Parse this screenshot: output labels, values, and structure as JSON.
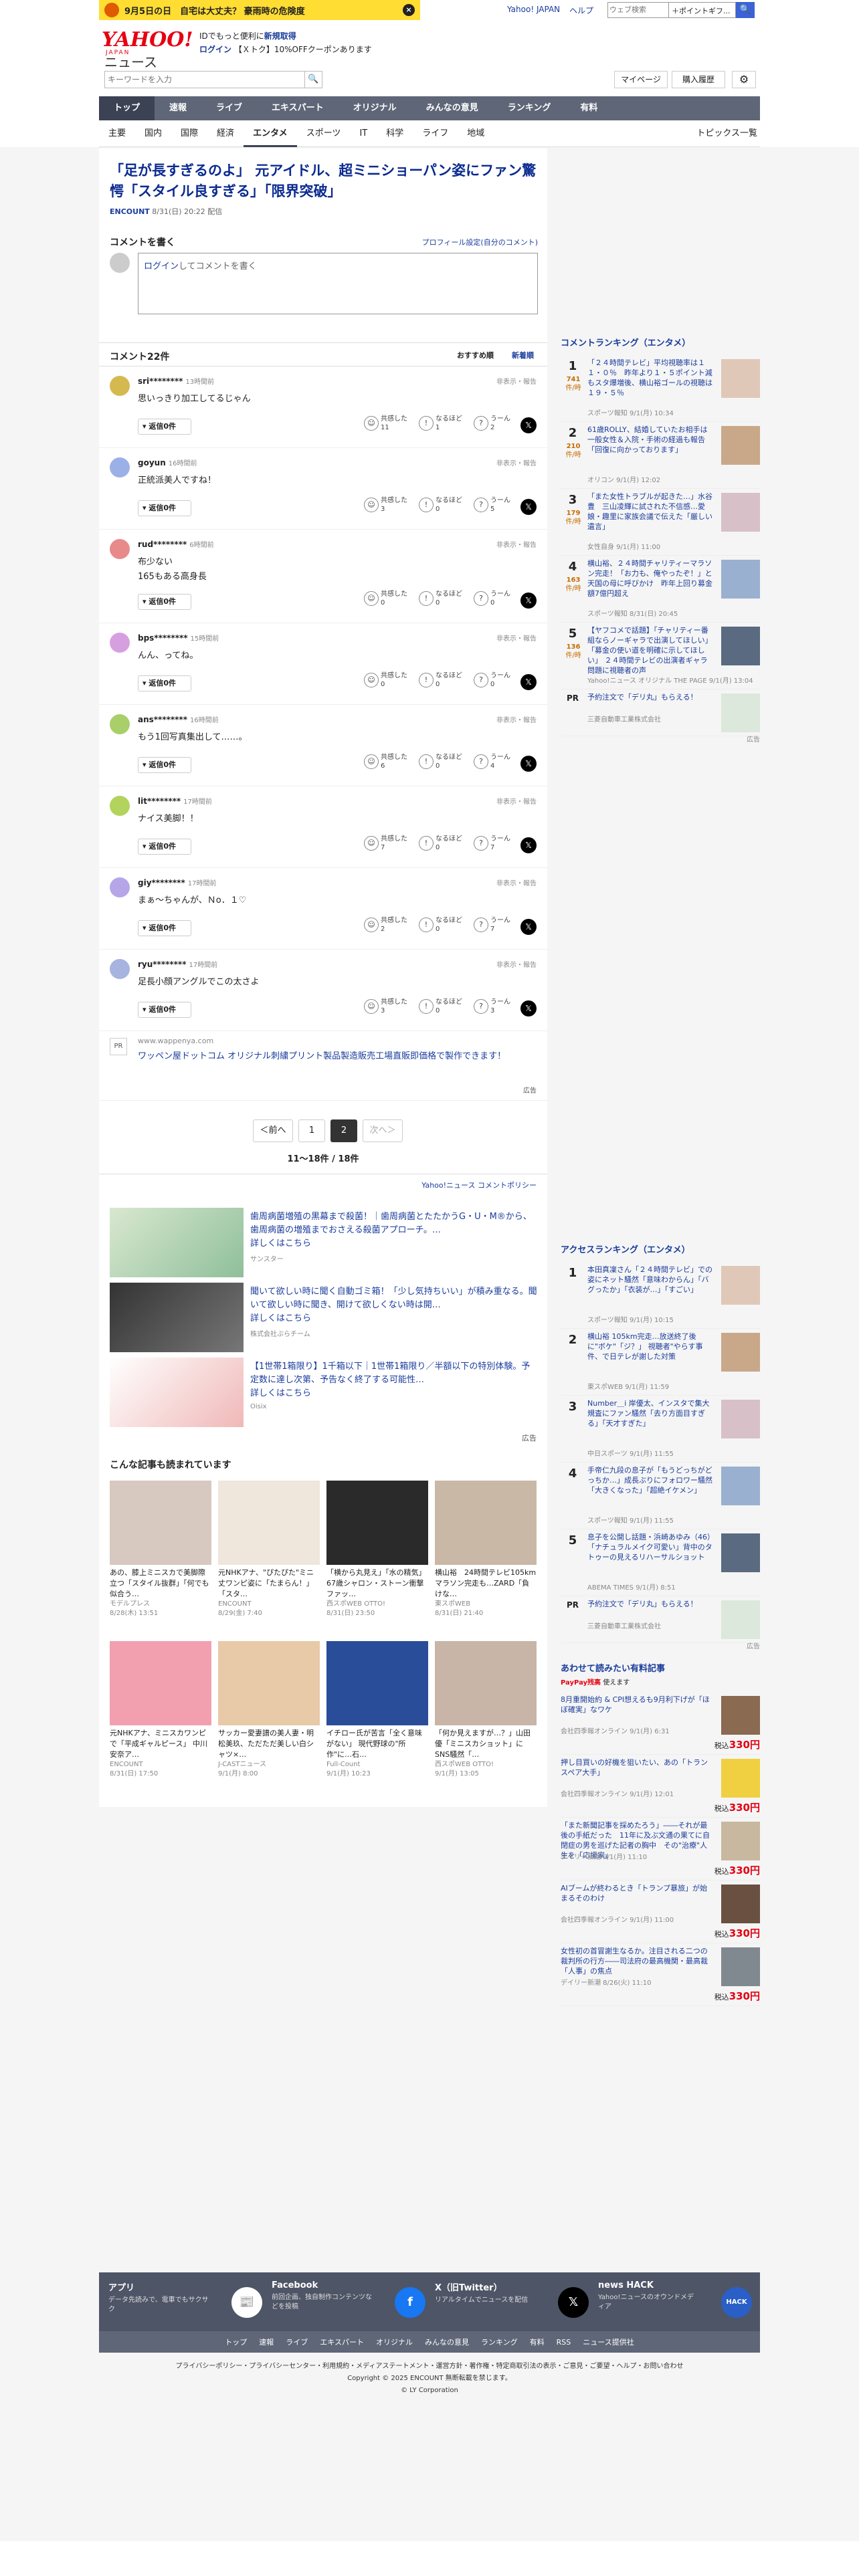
{
  "promo": {
    "text": "9月5日の日　自宅は大丈夫？ 豪雨時の危険度",
    "close": "×"
  },
  "toplinks": [
    "Yahoo! JAPAN",
    "ヘルプ"
  ],
  "topsearch": {
    "placeholder": "ウェブ検索",
    "select": "＋ポイントギフ...",
    "button": "🔍"
  },
  "logo": {
    "yahoo": "YAHOO!",
    "news": "ニュース",
    "japan": "JAPAN"
  },
  "header_info": {
    "line1": "IDでもっと便利に",
    "line1_link": "新規取得",
    "line2_login": "ログイン",
    "line2_text": "【Ｘトク】10%OFFクーポンあります"
  },
  "search": {
    "placeholder": "キーワードを入力",
    "mypage": "マイページ",
    "purchase": "購入履歴",
    "settings": "⚙"
  },
  "global_nav": [
    "トップ",
    "速報",
    "ライブ",
    "エキスパート",
    "オリジナル",
    "みんなの意見",
    "ランキング",
    "有料"
  ],
  "sub_nav": [
    "主要",
    "国内",
    "国際",
    "経済",
    "エンタメ",
    "スポーツ",
    "IT",
    "科学",
    "ライフ",
    "地域"
  ],
  "sub_nav_active": "エンタメ",
  "topics_list": "トピックス一覧",
  "article": {
    "title": "「足が長すぎるのよ」 元アイドル、超ミニショーパン姿にファン驚愕「スタイル良すぎる」「限界突破」",
    "source": "ENCOUNT",
    "date": "8/31(日) 20:22 配信"
  },
  "comment_write": {
    "title": "コメントを書く",
    "profile": "プロフィール設定(自分のコメント)",
    "login": "ログイン",
    "placeholder": "してコメントを書く"
  },
  "comments_header": {
    "title": "コメント22件",
    "sort1": "おすすめ順",
    "sort2": "新着順"
  },
  "comments": [
    {
      "user": "sri********",
      "time": "13時間前",
      "text": "思いっきり加工してるじゃん",
      "color": "#d4b94f",
      "kyokan": "11",
      "naruhodo": "1",
      "uun": "2"
    },
    {
      "user": "goyun",
      "time": "16時間前",
      "text": "正統派美人ですね！",
      "color": "#9bb0e6",
      "kyokan": "3",
      "naruhodo": "0",
      "uun": "5"
    },
    {
      "user": "rud********",
      "time": "6時間前",
      "text": "布少ない\n165もある高身長",
      "color": "#e88a8a",
      "kyokan": "0",
      "naruhodo": "0",
      "uun": "0"
    },
    {
      "user": "bps********",
      "time": "15時間前",
      "text": "んん、ってね。",
      "color": "#d6a0e0",
      "kyokan": "0",
      "naruhodo": "0",
      "uun": "0"
    },
    {
      "user": "ans********",
      "time": "16時間前",
      "text": "もう1回写真集出して……。",
      "color": "#a8cf6a",
      "kyokan": "6",
      "naruhodo": "0",
      "uun": "4"
    },
    {
      "user": "lit********",
      "time": "17時間前",
      "text": "ナイス美脚！！",
      "color": "#b2d35c",
      "kyokan": "7",
      "naruhodo": "0",
      "uun": "7"
    },
    {
      "user": "giy********",
      "time": "17時間前",
      "text": "まぁ〜ちゃんが、Ｎo．１♡",
      "color": "#b6a6e8",
      "kyokan": "2",
      "naruhodo": "0",
      "uun": "7"
    },
    {
      "user": "ryu********",
      "time": "17時間前",
      "text": "足長小顔アングルでこの太さよ",
      "color": "#a7b4e0",
      "kyokan": "3",
      "naruhodo": "0",
      "uun": "3"
    }
  ],
  "comment_labels": {
    "hide": "非表示・報告",
    "reply": "返信0件",
    "kyokan": "共感した",
    "naruhodo": "なるほど",
    "uun": "うーん"
  },
  "pr": {
    "label": "PR",
    "domain": "www.wappenya.com",
    "title": "ワッペン屋ドットコム オリジナル刺繍プリント製品製造販売工場直販即価格で製作できます！",
    "ad": "広告"
  },
  "pager": {
    "prev": "＜前へ",
    "p1": "1",
    "p2": "2",
    "next": "次へ＞",
    "count": "11〜18件 / 18件"
  },
  "policy": "Yahoo!ニュース コメントポリシー",
  "ads": [
    {
      "title": "歯周病菌増殖の黒幕まで殺菌！｜歯周病菌とたたかうG・U・M®から、歯周病菌の増殖までおさえる殺菌アプローチ。…",
      "more": "詳しくはこちら",
      "sponsor": "サンスター"
    },
    {
      "title": "聞いて欲しい時に聞く自動ゴミ箱！「少し気持ちいい」が積み重なる。聞いて欲しい時に聞き、開けて欲しくない時は開…",
      "more": "詳しくはこちら",
      "sponsor": "株式会社ぶらチーム"
    },
    {
      "title": "【1世帯1箱限り】1千箱以下｜1世帯1箱限り／半額以下の特別体験。予定数に達し次第、予告なく終了する可能性…",
      "more": "詳しくはこちら",
      "sponsor": "Oisix"
    }
  ],
  "ad_label": "広告",
  "reading_title": "こんな記事も読まれています",
  "reading": [
    {
      "title": "あの、膝上ミニスカで美脚際立つ「スタイル抜群」「何でも似合う…",
      "src": "モデルプレス",
      "date": "8/28(木) 13:51"
    },
    {
      "title": "元NHKアナ、\"ぴたぴた\"ミニ丈ワンピ姿に「たまらん！」「スタ…",
      "src": "ENCOUNT",
      "date": "8/29(金) 7:40"
    },
    {
      "title": "「横から丸見え」「水の精気」67歳シャロン・ストーン衝撃ファッ…",
      "src": "西スポWEB OTTO!",
      "date": "8/31(日) 23:50"
    },
    {
      "title": "横山裕　24時間テレビ105kmマラソン完走も…ZARD「負けな…",
      "src": "東スポWEB",
      "date": "8/31(日) 21:40"
    },
    {
      "title": "元NHKアナ、ミニスカワンピで「平成ギャルピース」 中川安奈ア…",
      "src": "ENCOUNT",
      "date": "8/31(日) 17:50"
    },
    {
      "title": "サッカー愛妻譜の美人妻・明松美玖、ただただ美しい白シャツ×…",
      "src": "J-CASTニュース",
      "date": "9/1(月) 8:00"
    },
    {
      "title": "イチロー氏が苦言「全く意味がない」 現代野球の\"所作\"に…石…",
      "src": "Full-Count",
      "date": "9/1(月) 10:23"
    },
    {
      "title": "「何か見えますが…？」山田優「ミニスカショット」にSNS騒然「…",
      "src": "西スポWEB OTTO!",
      "date": "9/1(月) 13:05"
    }
  ],
  "side_ranking": {
    "title": "コメントランキング（エンタメ）",
    "unit": "件/時",
    "items": [
      {
        "no": "1",
        "count": "741",
        "title": "「２４時間テレビ」平均視聴率は１１・０％　昨年より１・５ポイント減もスタ爆増後、横山裕ゴールの視聴は１９・５％",
        "src": "スポーツ報知 9/1(月) 10:34"
      },
      {
        "no": "2",
        "count": "210",
        "title": "61歳ROLLY、結婚していたお相手は一般女性＆入院・手術の経過も報告「回復に向かっております」",
        "src": "オリコン 9/1(月) 12:02"
      },
      {
        "no": "3",
        "count": "179",
        "title": "「また女性トラブルが起きた…」水谷豊　三山凌輝に試された不信感…愛娘・趣里に家族会議で伝えた「厳しい遺言」",
        "src": "女性自身 9/1(月) 11:00"
      },
      {
        "no": "4",
        "count": "163",
        "title": "横山裕、２４時間チャリティーマラソン完走！「お力も、俺やったぞ！」と天国の母に呼びかけ　昨年上回り募金額7億円超え",
        "src": "スポーツ報知 8/31(日) 20:45"
      },
      {
        "no": "5",
        "count": "136",
        "title": "【ヤフコメで話題】「チャリティー番組ならノーギャラで出演してほしい」「募金の使い道を明確に示してほしい」 ２４時間テレビの出演者ギャラ問題に視聴者の声",
        "src": "Yahoo!ニュース オリジナル THE PAGE 9/1(月) 13:04"
      }
    ]
  },
  "side_pr": {
    "label": "PR",
    "title": "予約注文で「デリ丸」もらえる！",
    "src": "三菱自動車工業株式会社",
    "ad": "広告"
  },
  "access_ranking": {
    "title": "アクセスランキング（エンタメ）",
    "items": [
      {
        "no": "1",
        "title": "本田真凜さん「２４時間テレビ」での姿にネット騒然「意味わからん」「バグったか」「衣装が…」「すごい」",
        "src": "スポーツ報知 9/1(月) 10:15"
      },
      {
        "no": "2",
        "title": "横山裕 105km完走…放送終了後に\"ボケ\"「ジ？」 視聴者\"やらす事件、で日テレが謝した対策",
        "src": "東スポWEB 9/1(月) 11:59"
      },
      {
        "no": "3",
        "title": "Number＿i 岸優太、インスタで集大規査にファン騒然「去り方面目すぎる」「天才すぎた」",
        "src": "中日スポーツ 9/1(月) 11:55"
      },
      {
        "no": "4",
        "title": "手帝仁九段の息子が「もうどっちがどっちか…」成長ぶりにフォロワー騒然「大きくなった」「超絶イケメン」",
        "src": "スポーツ報知 9/1(月) 11:55"
      },
      {
        "no": "5",
        "title": "息子を公開し話題・浜崎あゆみ（46）「ナチュラルメイク可愛い」背中のタトゥーの見えるリハーサルショット",
        "src": "ABEMA TIMES 9/1(月) 8:51"
      }
    ]
  },
  "side_pr2": {
    "label": "PR",
    "title": "予約注文で「デリ丸」もらえる！",
    "src": "三菱自動車工業株式会社",
    "ad": "広告"
  },
  "paid": {
    "title": "あわせて読みたい有料記事",
    "badge": "PayPay残高",
    "badge_text": "使えます",
    "price_label": "税込",
    "items": [
      {
        "title": "8月重開始約 & CPI想えるも9月利下げが「ほぼ確実」なワケ",
        "src": "会社四季報オンライン 9/1(月) 6:31",
        "price": "330円"
      },
      {
        "title": "押し目買いの好機を狙いたい、あの「トランスペア大手」",
        "src": "会社四季報オンライン 9/1(月) 12:01",
        "price": "330円"
      },
      {
        "title": "「また新聞記事を採めたろう」――それが最後の手紙だった　11年に及ぶ文通の果てに自閉症の男を巡げた記者の胸中　その\"治療\"人生を「応援家」",
        "src": "デイリー新潮 9/1(月) 11:10",
        "price": "330円"
      },
      {
        "title": "AIブームが終わるとき「トランプ暴旅」が始まるそのわけ",
        "src": "会社四季報オンライン 9/1(月) 11:00",
        "price": "330円"
      },
      {
        "title": "女性初の首冒謝生なるか。注目される二つの裁判所の行方――司法府の最高機関・最高裁「人事」の焦点",
        "src": "デイリー新潮 8/26(火) 11:10",
        "price": "330円"
      }
    ]
  },
  "footer": {
    "cards": [
      {
        "title": "アプリ",
        "desc": "データ先読みで、電車でもサクサク",
        "icon": "📰"
      },
      {
        "title": "Facebook",
        "desc": "前回企画、独自制作コンテンツなどを投稿",
        "icon": "f"
      },
      {
        "title": "X（旧Twitter）",
        "desc": "リアルタイムでニュースを配信",
        "icon": "𝕏"
      },
      {
        "title": "news HACK",
        "desc": "Yahoo!ニュースのオウンドメディア",
        "icon": "HACK"
      }
    ],
    "nav": [
      "トップ",
      "速報",
      "ライブ",
      "エキスパート",
      "オリジナル",
      "みんなの意見",
      "ランキング",
      "有料",
      "RSS",
      "ニュース提供社"
    ],
    "links": "プライバシーポリシー・プライバシーセンター・利用規約・メディアステートメント・運営方針・著作権・特定商取引法の表示・ご意見・ご要望・ヘルプ・お問い合わせ",
    "copyright": "Copyright © 2025 ENCOUNT 無断転載を禁じます。",
    "corp": "© LY Corporation"
  }
}
